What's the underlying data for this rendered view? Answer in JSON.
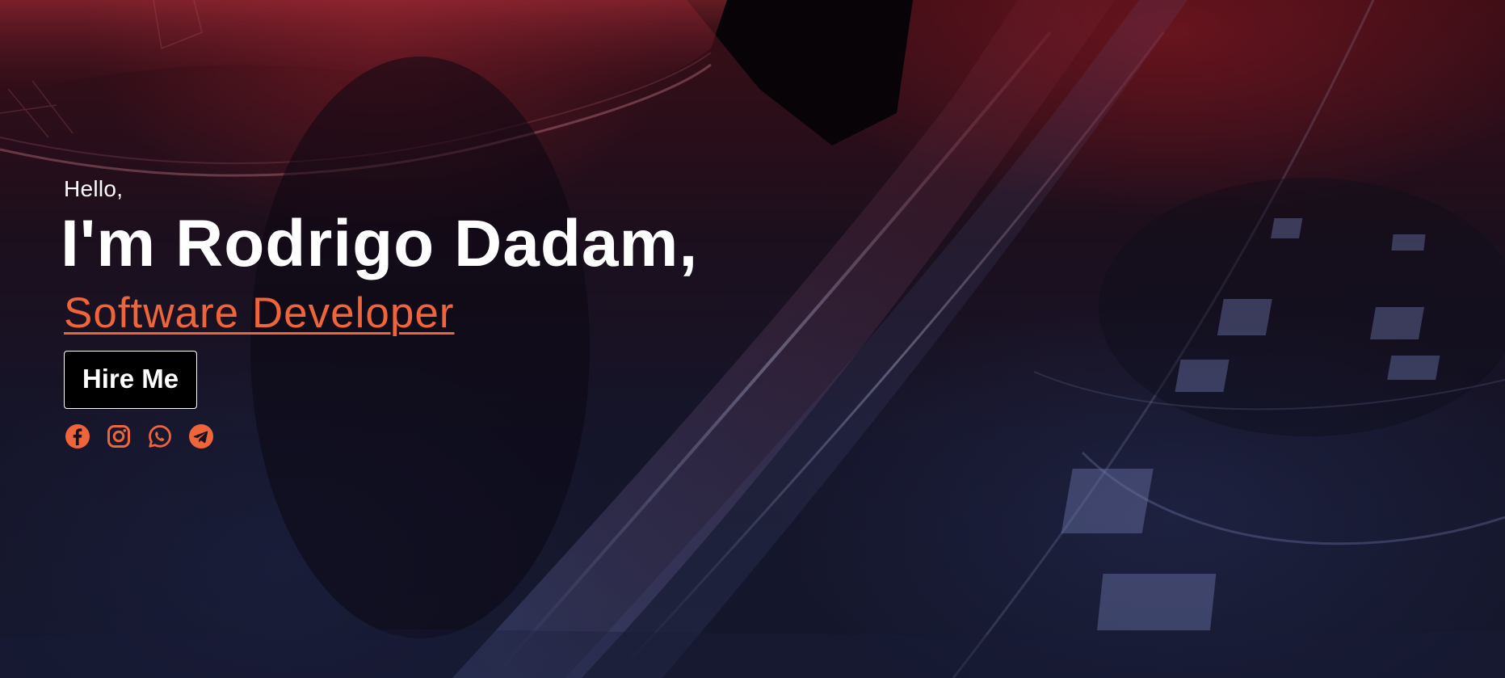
{
  "hero": {
    "greeting": "Hello,",
    "name": "I'm Rodrigo Dadam,",
    "role": "Software Developer",
    "hire_button": "Hire Me"
  },
  "socials": [
    {
      "icon": "facebook-icon"
    },
    {
      "icon": "instagram-icon"
    },
    {
      "icon": "whatsapp-icon"
    },
    {
      "icon": "telegram-icon"
    }
  ],
  "colors": {
    "accent": "#f0643a",
    "text": "#ffffff",
    "button_bg": "#000000",
    "bg_top": "#3a0d15",
    "bg_bottom": "#14172c"
  }
}
